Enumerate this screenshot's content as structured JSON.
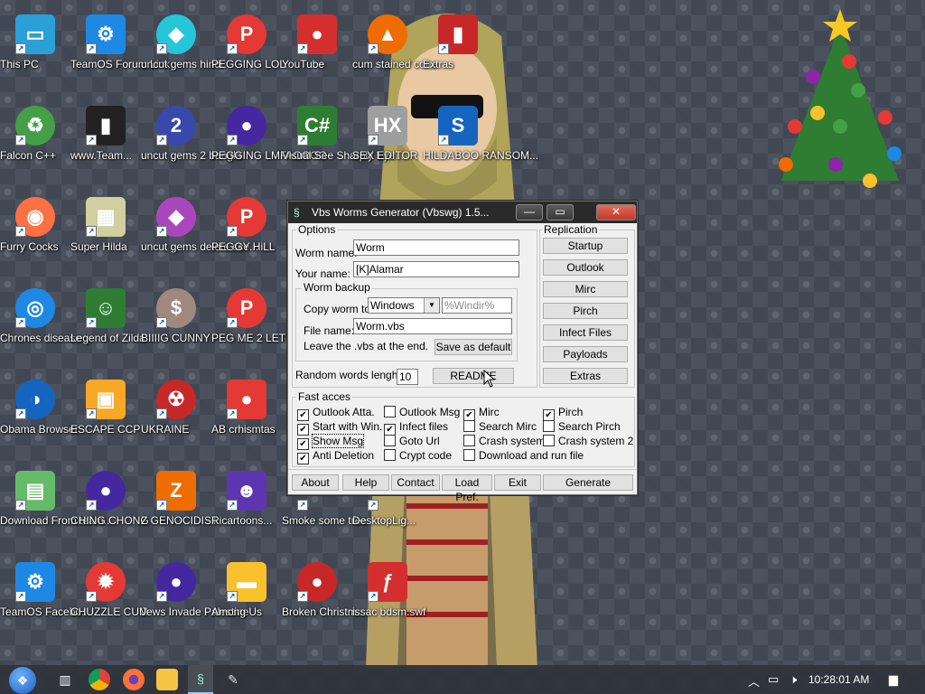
{
  "desktop": {
    "icons": [
      {
        "label": "This PC",
        "glyph": "▭",
        "color": "#2a9fd8",
        "shape": "sq"
      },
      {
        "label": "TeamOS Forum Link",
        "glyph": "⚙",
        "color": "#1e88e5",
        "shape": "sq"
      },
      {
        "label": "uncut gems hindi",
        "glyph": "◆",
        "color": "#26c6da",
        "shape": "round"
      },
      {
        "label": "PEGGING LOL",
        "glyph": "P",
        "color": "#e53935",
        "shape": "round"
      },
      {
        "label": "YouTube",
        "glyph": "●",
        "color": "#d32f2f",
        "shape": "sq"
      },
      {
        "label": "cum stained cone",
        "glyph": "▲",
        "color": "#ef6c00",
        "shape": "round"
      },
      {
        "label": "Extras",
        "glyph": "▮",
        "color": "#c62828",
        "shape": "sq"
      },
      {
        "label": "Falcon C++",
        "glyph": "♻",
        "color": "#43a047",
        "shape": "round"
      },
      {
        "label": "www.Team...",
        "glyph": "▮",
        "color": "#222222",
        "shape": "sq"
      },
      {
        "label": "uncut gems 2 bangla",
        "glyph": "2",
        "color": "#3949ab",
        "shape": "round"
      },
      {
        "label": "PEGGING LMFAOOOO",
        "glyph": "●",
        "color": "#4527a0",
        "shape": "round"
      },
      {
        "label": "Visual See Sharply Eye...",
        "glyph": "C#",
        "color": "#2e7d32",
        "shape": "sq"
      },
      {
        "label": "SEX EDITOR",
        "glyph": "HX",
        "color": "#9e9e9e",
        "shape": "sq"
      },
      {
        "label": "HILDABOO RANSOM...",
        "glyph": "S",
        "color": "#1565c0",
        "shape": "sq"
      },
      {
        "label": "Furry Cocks",
        "glyph": "◉",
        "color": "#ff7043",
        "shape": "round"
      },
      {
        "label": "Super Hilda",
        "glyph": "▦",
        "color": "#cfcfa0",
        "shape": "sq"
      },
      {
        "label": "uncut gems delete sce...",
        "glyph": "◆",
        "color": "#ab47bc",
        "shape": "round"
      },
      {
        "label": "PEGGY HiLL",
        "glyph": "P",
        "color": "#e53935",
        "shape": "round"
      },
      {
        "label": "Chrones disease",
        "glyph": "◎",
        "color": "#1e88e5",
        "shape": "round"
      },
      {
        "label": "Legend of Zilda",
        "glyph": "☺",
        "color": "#2e7d32",
        "shape": "sq"
      },
      {
        "label": "BIIIIG CUNNY",
        "glyph": "$",
        "color": "#a1887f",
        "shape": "round"
      },
      {
        "label": "PEG ME 2 LET OFF STEAM",
        "glyph": "P",
        "color": "#e53935",
        "shape": "round"
      },
      {
        "label": "Obama Browser",
        "glyph": "◑",
        "color": "#1565c0",
        "shape": "round"
      },
      {
        "label": "ESCAPE CCP",
        "glyph": "▣",
        "color": "#f9a825",
        "shape": "sq"
      },
      {
        "label": "UKRAINE",
        "glyph": "☢",
        "color": "#c62828",
        "shape": "round"
      },
      {
        "label": "AB crhismtas",
        "glyph": "●",
        "color": "#e53935",
        "shape": "sq"
      },
      {
        "label": "Download From team...",
        "glyph": "▤",
        "color": "#66bb6a",
        "shape": "sq"
      },
      {
        "label": "CHING CHONG",
        "glyph": "●",
        "color": "#4527a0",
        "shape": "round"
      },
      {
        "label": "Z GENOCIDIST",
        "glyph": "Z",
        "color": "#ef6c00",
        "shape": "sq"
      },
      {
        "label": "Ricartoons...",
        "glyph": "☻",
        "color": "#5e35b1",
        "shape": "sq"
      },
      {
        "label": "Smoke some tree",
        "glyph": "",
        "color": "transparent",
        "shape": "sq"
      },
      {
        "label": "DesktopLig...",
        "glyph": "",
        "color": "transparent",
        "shape": "sq"
      },
      {
        "label": "TeamOS Facebo...",
        "glyph": "⚙",
        "color": "#1e88e5",
        "shape": "sq"
      },
      {
        "label": "CHUZZLE CUM",
        "glyph": "✹",
        "color": "#e53935",
        "shape": "round"
      },
      {
        "label": "Jews Invade Palestine",
        "glyph": "●",
        "color": "#4527a0",
        "shape": "round"
      },
      {
        "label": "Among Us",
        "glyph": "▬",
        "color": "#fbc02d",
        "shape": "sq"
      },
      {
        "label": "Broken Christm...",
        "glyph": "●",
        "color": "#c62828",
        "shape": "round"
      },
      {
        "label": "issac bdsm.swf",
        "glyph": "ƒ",
        "color": "#d32f2f",
        "shape": "sq"
      }
    ]
  },
  "dialog": {
    "title": "Vbs Worms Generator (Vbswg) 1.5...",
    "window_buttons": {
      "minimize": "—",
      "maximize": "▭",
      "close": "✕"
    },
    "options": {
      "group_label": "Options",
      "worm_name_label": "Worm name:",
      "worm_name_value": "Worm",
      "your_name_label": "Your name:",
      "your_name_value": "[K]Alamar",
      "worm_backup": {
        "group_label": "Worm backup",
        "copy_worm_to_label": "Copy worm to:",
        "copy_worm_to_value": "Windows",
        "path_value": "%Windir%",
        "file_name_label": "File name:",
        "file_name_value": "Worm.vbs",
        "note": "Leave the .vbs at the end.",
        "save_default_button": "Save as default"
      },
      "random_words_label": "Random words lenght:",
      "random_words_value": "10",
      "readme_button": "README"
    },
    "replication": {
      "group_label": "Replication",
      "buttons": [
        "Startup",
        "Outlook",
        "Mirc",
        "Pirch",
        "Infect Files",
        "Payloads",
        "Extras"
      ]
    },
    "fast_access": {
      "group_label": "Fast acces",
      "checkboxes": [
        {
          "label": "Outlook Atta.",
          "checked": true
        },
        {
          "label": "Start with Win.",
          "checked": true
        },
        {
          "label": "Show Msg",
          "checked": true
        },
        {
          "label": "Anti Deletion",
          "checked": true
        },
        {
          "label": "Outlook Msg",
          "checked": false
        },
        {
          "label": "Infect files",
          "checked": true
        },
        {
          "label": "Goto Url",
          "checked": false
        },
        {
          "label": "Crypt code",
          "checked": false
        },
        {
          "label": "Mirc",
          "checked": true
        },
        {
          "label": "Search Mirc",
          "checked": false
        },
        {
          "label": "Crash system",
          "checked": false
        },
        {
          "label": "Download and run file",
          "checked": false
        },
        {
          "label": "Pirch",
          "checked": true
        },
        {
          "label": "Search Pirch",
          "checked": false
        },
        {
          "label": "Crash system 2",
          "checked": false
        }
      ]
    },
    "bottom_buttons": [
      "About",
      "Help",
      "Contact",
      "Load Pref.",
      "Exit",
      "Generate"
    ]
  },
  "taskbar": {
    "clock": "10:28:01 AM",
    "tray_icons": [
      "chevron-up-icon",
      "network-icon",
      "volume-icon",
      "notification-icon"
    ],
    "pinned": [
      "start-orb-icon",
      "task-view-icon",
      "chrome-icon",
      "firefox-icon",
      "file-explorer-icon",
      "vbswg-icon",
      "paint-icon"
    ]
  }
}
